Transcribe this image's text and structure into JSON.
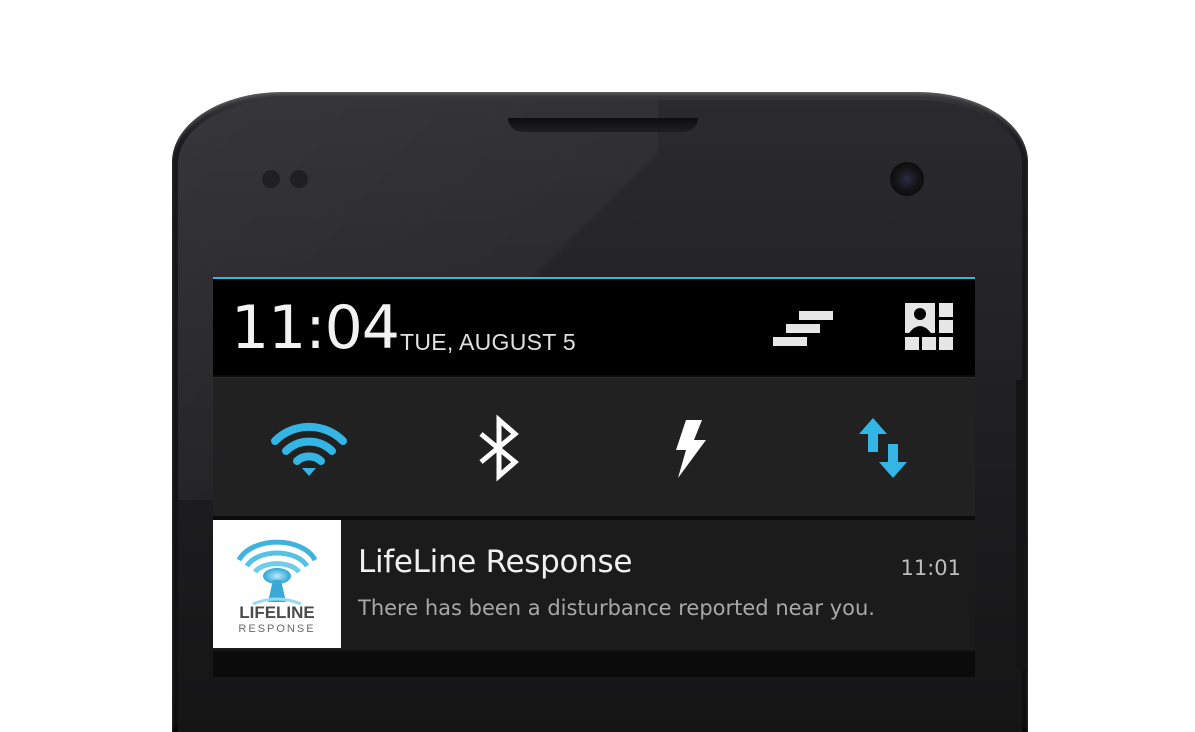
{
  "status_header": {
    "time": "11:04",
    "date": "TUE, AUGUST 5",
    "settings_icon": "settings-bars-icon",
    "user_icon": "user-switcher-icon"
  },
  "quick_settings": [
    {
      "name": "wifi",
      "icon": "wifi-icon",
      "color": "#33b5e5"
    },
    {
      "name": "bluetooth",
      "icon": "bluetooth-icon",
      "color": "#ffffff"
    },
    {
      "name": "power",
      "icon": "lightning-icon",
      "color": "#ffffff"
    },
    {
      "name": "mobile-data",
      "icon": "data-arrows-icon",
      "color": "#33b5e5"
    }
  ],
  "notification": {
    "app_name": "LifeLine Response",
    "time": "11:01",
    "message": "There has been a disturbance reported near you.",
    "logo_text_top": "LIFELINE",
    "logo_text_bottom": "RESPONSE"
  },
  "colors": {
    "accent": "#33b5e5",
    "header_bg": "#000000",
    "panel_bg": "#212121"
  }
}
